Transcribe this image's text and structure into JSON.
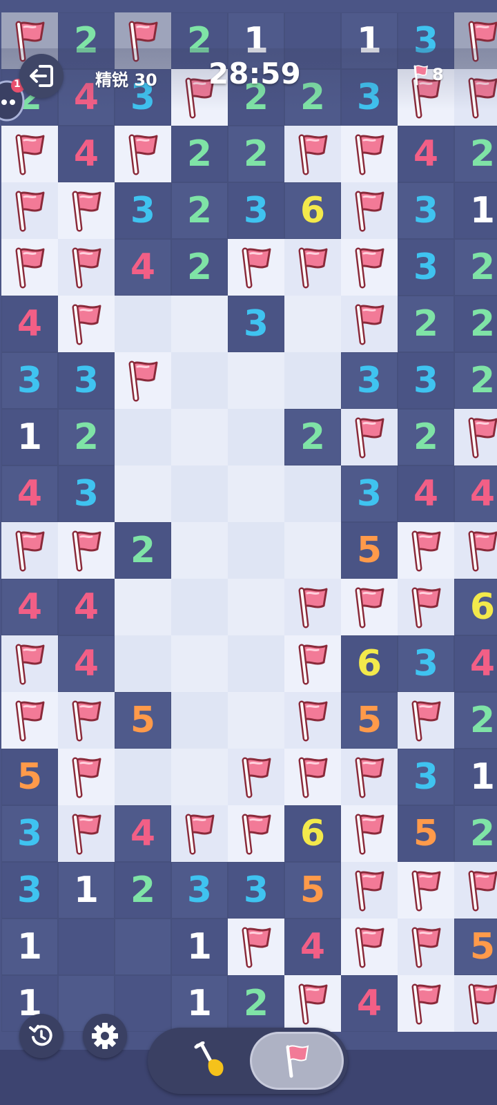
{
  "header": {
    "level_label": "精锐 30",
    "timer": "28:59",
    "flags_remaining": "8",
    "bubble_badge": "1"
  },
  "board": {
    "rows": [
      [
        "F",
        "2",
        "F",
        "2",
        "1",
        "",
        "1",
        "3",
        "F"
      ],
      [
        "2",
        "4",
        "3",
        "F",
        "2",
        "2",
        "3",
        "F",
        "F"
      ],
      [
        "F",
        "4",
        "F",
        "2",
        "2",
        "F",
        "F",
        "4",
        "2"
      ],
      [
        "F",
        "F",
        "3",
        "2",
        "3",
        "6",
        "F",
        "3",
        "1"
      ],
      [
        "F",
        "F",
        "4",
        "2",
        "F",
        "F",
        "F",
        "3",
        "2"
      ],
      [
        "4",
        "F",
        "",
        "",
        "3",
        "",
        "F",
        "2",
        "2"
      ],
      [
        "3",
        "3",
        "F",
        "",
        "",
        "",
        "3",
        "3",
        "2"
      ],
      [
        "1",
        "2",
        "",
        "",
        "",
        "2",
        "F",
        "2",
        "F"
      ],
      [
        "4",
        "3",
        "",
        "",
        "",
        "",
        "3",
        "4",
        "4"
      ],
      [
        "F",
        "F",
        "2",
        "",
        "",
        "",
        "5",
        "F",
        "F"
      ],
      [
        "4",
        "4",
        "",
        "",
        "",
        "F",
        "F",
        "F",
        "6"
      ],
      [
        "F",
        "4",
        "",
        "",
        "",
        "F",
        "6",
        "3",
        "4"
      ],
      [
        "F",
        "F",
        "5",
        "",
        "",
        "F",
        "5",
        "F",
        "2"
      ],
      [
        "5",
        "F",
        "",
        "",
        "F",
        "F",
        "F",
        "3",
        "1"
      ],
      [
        "3",
        "F",
        "4",
        "F",
        "F",
        "6",
        "F",
        "5",
        "2"
      ],
      [
        "3",
        "1",
        "2",
        "3",
        "3",
        "5",
        "F",
        "F",
        "F"
      ],
      [
        "1",
        "",
        "",
        "1",
        "F",
        "4",
        "F",
        "F",
        "5"
      ],
      [
        "1",
        "",
        "",
        "1",
        "2",
        "F",
        "4",
        "F",
        "F"
      ]
    ]
  },
  "colors": {
    "1": "#ffffff",
    "2": "#7fe3a6",
    "3": "#3fc3f0",
    "4": "#f25f86",
    "5": "#ff9a4a",
    "6": "#f3e94b"
  },
  "icons": {
    "exit": "exit-icon",
    "restart": "restart-icon",
    "settings": "gear-icon",
    "dig": "shovel-icon",
    "flag": "flag-icon"
  }
}
